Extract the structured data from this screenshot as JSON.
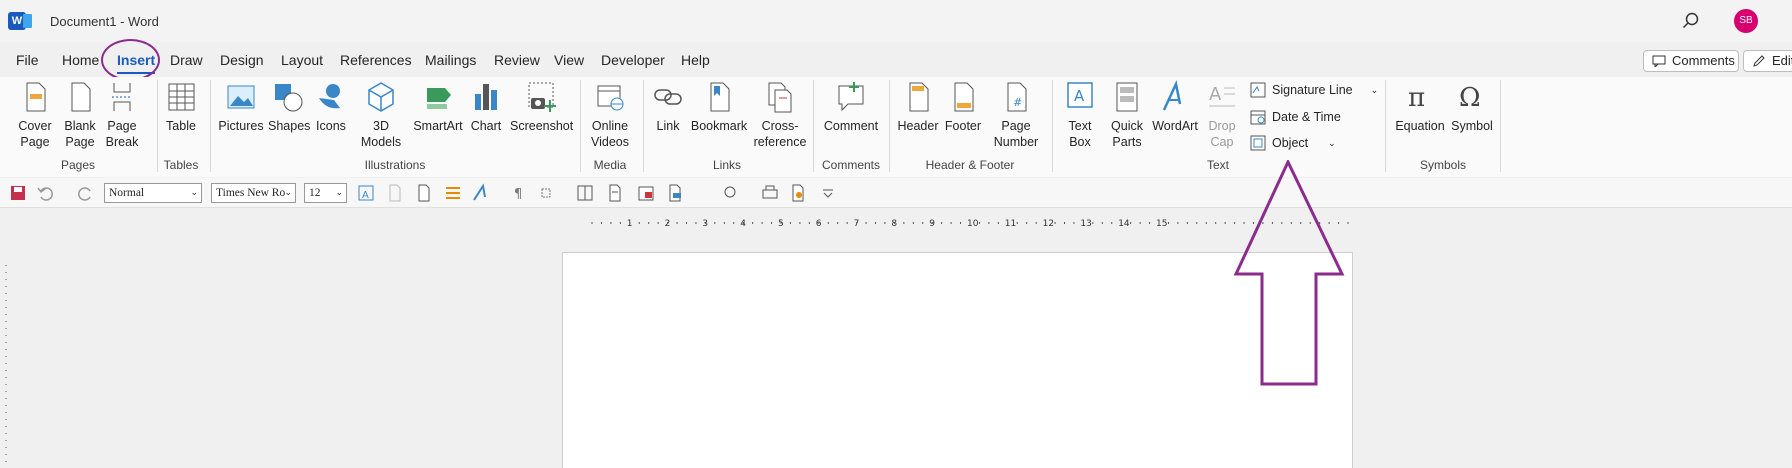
{
  "titlebar": {
    "app_icon": "word-logo-icon",
    "title": "Document1  -  Word",
    "avatar_initials": "SB"
  },
  "tabs": [
    "File",
    "Home",
    "Insert",
    "Draw",
    "Design",
    "Layout",
    "References",
    "Mailings",
    "Review",
    "View",
    "Developer",
    "Help"
  ],
  "active_tab": "Insert",
  "top_buttons": {
    "comments": "Comments",
    "editing": "Editi"
  },
  "ribbon": {
    "pages": {
      "label": "Pages",
      "cover_page": "Cover\nPage",
      "blank_page": "Blank\nPage",
      "page_break": "Page\nBreak"
    },
    "tables": {
      "label": "Tables",
      "table": "Table"
    },
    "illustrations": {
      "label": "Illustrations",
      "pictures": "Pictures",
      "shapes": "Shapes",
      "icons": "Icons",
      "models": "3D\nModels",
      "smartart": "SmartArt",
      "chart": "Chart",
      "screenshot": "Screenshot"
    },
    "media": {
      "label": "Media",
      "online_videos": "Online\nVideos"
    },
    "links": {
      "label": "Links",
      "link": "Link",
      "bookmark": "Bookmark",
      "cross_reference": "Cross-\nreference"
    },
    "comments": {
      "label": "Comments",
      "comment": "Comment"
    },
    "header_footer": {
      "label": "Header & Footer",
      "header": "Header",
      "footer": "Footer",
      "page_number": "Page\nNumber"
    },
    "text": {
      "label": "Text",
      "text_box": "Text\nBox",
      "quick_parts": "Quick\nParts",
      "wordart": "WordArt",
      "drop_cap": "Drop\nCap",
      "signature_line": "Signature Line",
      "date_time": "Date & Time",
      "object": "Object"
    },
    "symbols": {
      "label": "Symbols",
      "equation": "Equation",
      "symbol": "Symbol"
    }
  },
  "qat": {
    "style": "Normal",
    "font": "Times New Ro",
    "size": "12"
  },
  "ruler_numbers": [
    "1",
    "2",
    "3",
    "4",
    "5",
    "6",
    "7",
    "8",
    "9",
    "10",
    "11",
    "12",
    "13",
    "14",
    "15"
  ],
  "colors": {
    "accent": "#185abd",
    "annotation": "#8b2b8e",
    "avatar": "#d6006f"
  }
}
